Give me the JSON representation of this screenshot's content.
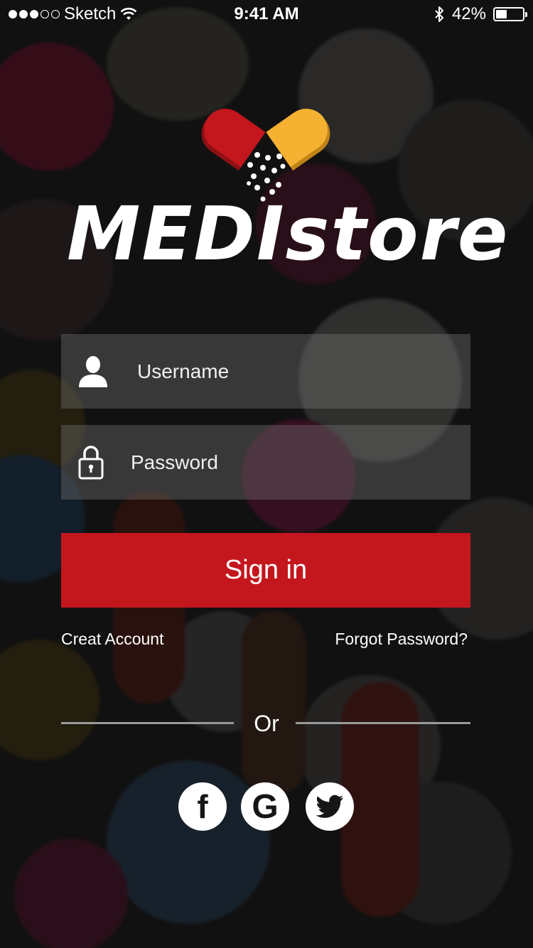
{
  "status_bar": {
    "carrier": "Sketch",
    "time": "9:41 AM",
    "battery": "42%",
    "battery_level": 0.42
  },
  "logo": {
    "text": "MEDIstore"
  },
  "form": {
    "username_placeholder": "Username",
    "password_placeholder": "Password",
    "signin_label": "Sign in"
  },
  "links": {
    "create_account": "Creat Account",
    "forgot_password": "Forgot Password?"
  },
  "separator": {
    "text": "Or"
  },
  "social": {
    "facebook_glyph": "f",
    "google_glyph": "G",
    "icons": [
      "facebook-icon",
      "google-icon",
      "twitter-icon"
    ]
  },
  "colors": {
    "accent": "#c4161d",
    "capsule_red": "#c4161d",
    "capsule_yellow": "#f5b131",
    "background": "#1c1b1b"
  }
}
